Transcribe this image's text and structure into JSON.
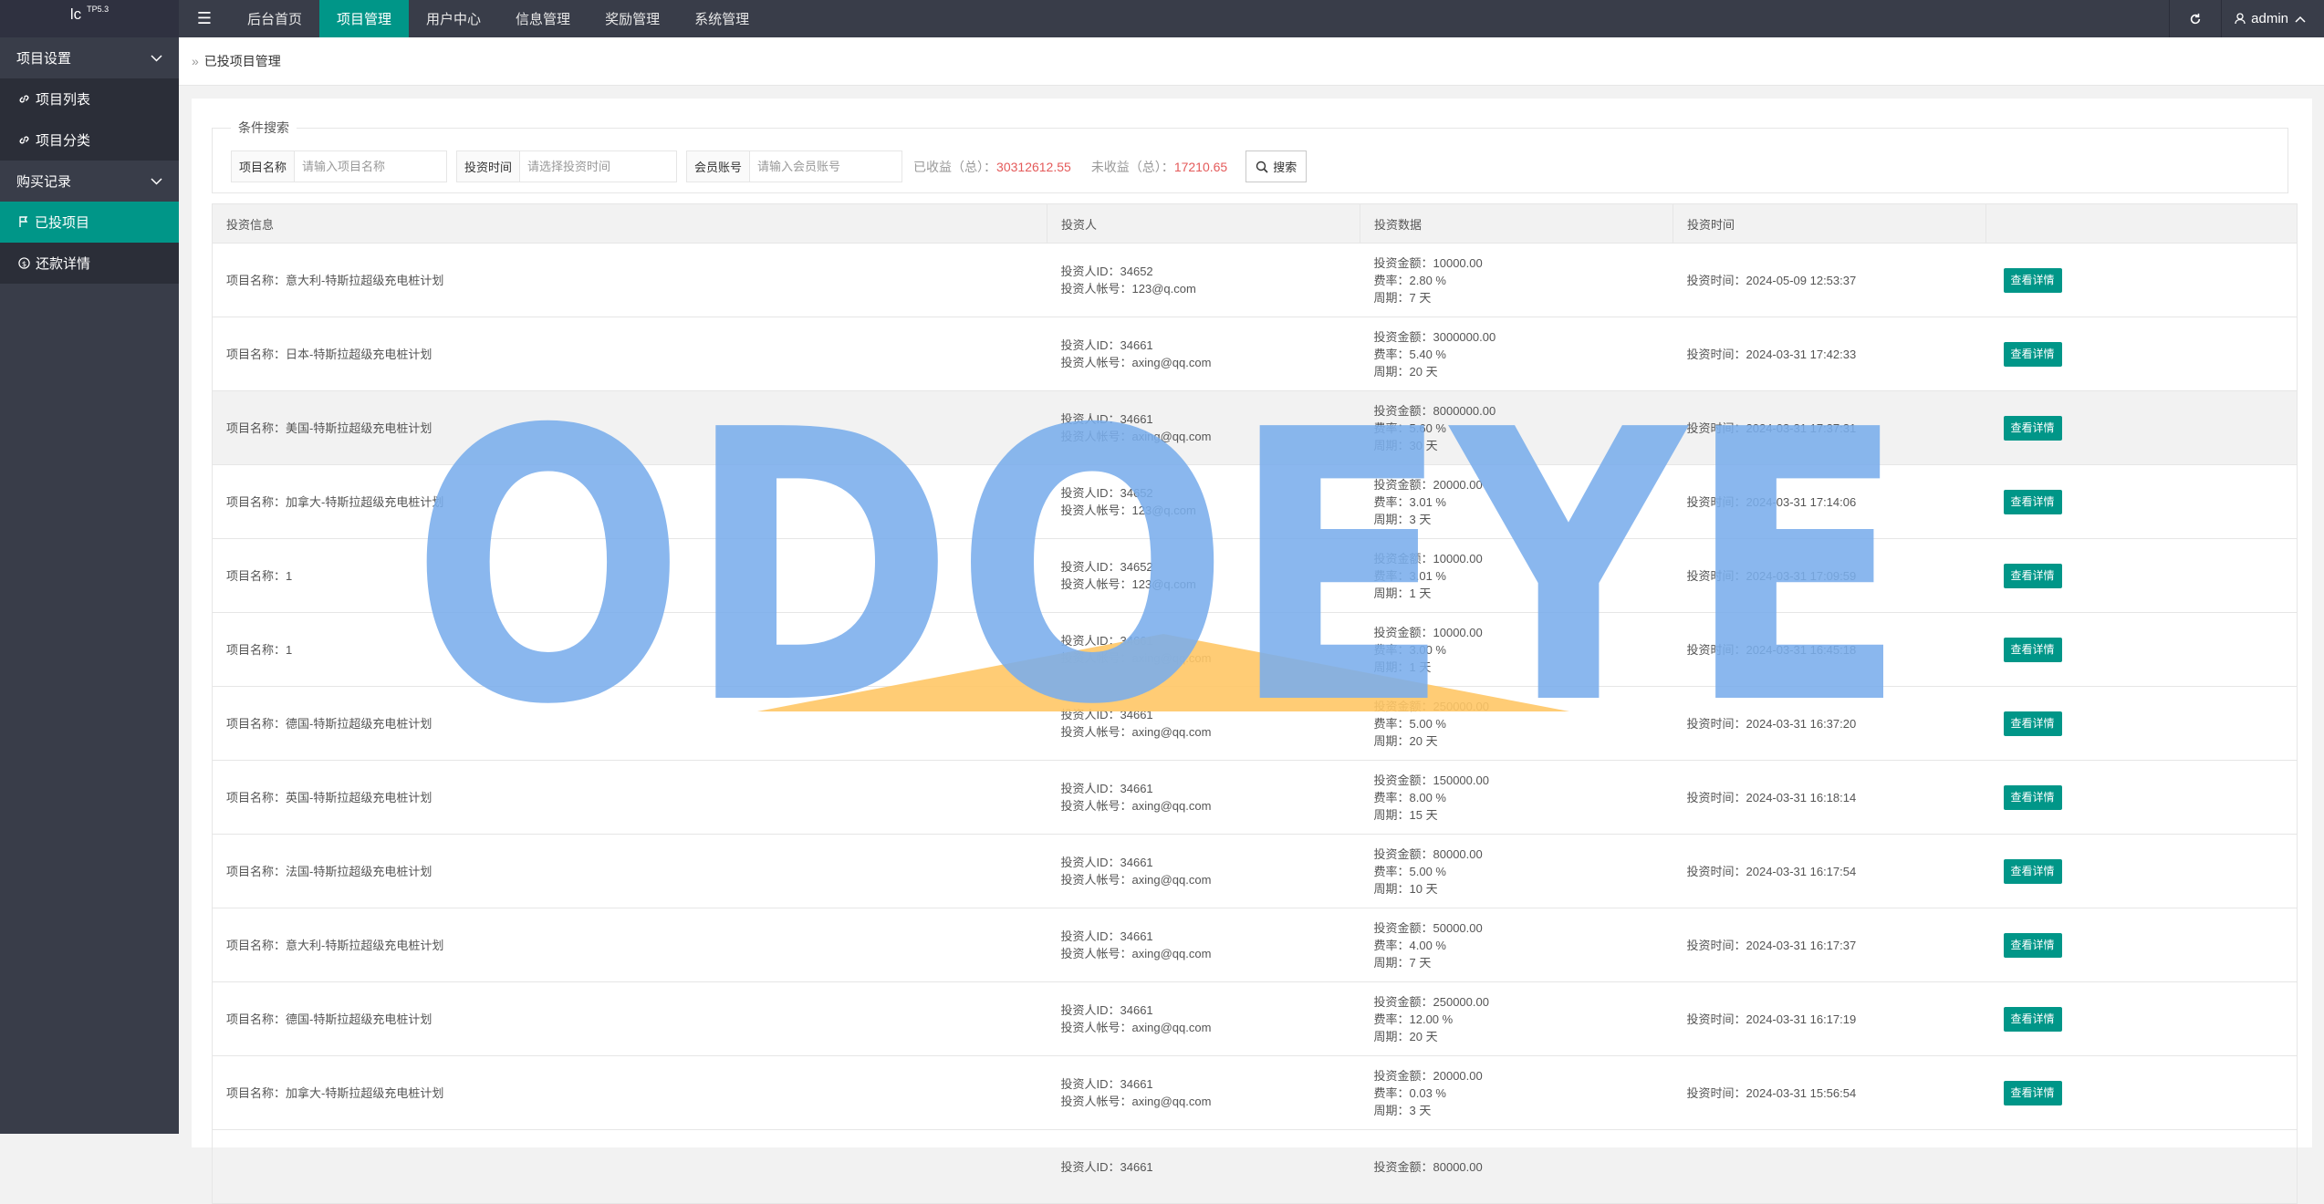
{
  "app": {
    "logo": "lc",
    "version": "TP5.3"
  },
  "topnav": {
    "items": [
      "后台首页",
      "项目管理",
      "用户中心",
      "信息管理",
      "奖励管理",
      "系统管理"
    ],
    "user": "admin"
  },
  "sidebar": {
    "groups": [
      {
        "label": "项目设置",
        "items": [
          "项目列表",
          "项目分类"
        ]
      },
      {
        "label": "购买记录",
        "items": [
          "已投项目",
          "还款详情"
        ]
      }
    ]
  },
  "breadcrumb": {
    "title": "已投项目管理"
  },
  "search": {
    "legend": "条件搜索",
    "fields": [
      {
        "label": "项目名称",
        "placeholder": "请输入项目名称"
      },
      {
        "label": "投资时间",
        "placeholder": "请选择投资时间"
      },
      {
        "label": "会员账号",
        "placeholder": "请输入会员账号"
      }
    ],
    "earned_label": "已收益（总）：",
    "earned_value": "30312612.55",
    "unearned_label": "未收益（总）：",
    "unearned_value": "17210.65",
    "button": "搜索"
  },
  "table": {
    "headers": [
      "投资信息",
      "投资人",
      "投资数据",
      "投资时间",
      ""
    ],
    "detail_label": "查看详情",
    "rows": [
      {
        "name": "项目名称：意大利-特斯拉超级充电桩计划",
        "uid": "投资人ID：34652",
        "account": "投资人帐号：123@q.com",
        "amount": "投资金额：10000.00",
        "rate": "费率：2.80 %",
        "period": "周期：7 天",
        "time": "投资时间：2024-05-09 12:53:37"
      },
      {
        "name": "项目名称：日本-特斯拉超级充电桩计划",
        "uid": "投资人ID：34661",
        "account": "投资人帐号：axing@qq.com",
        "amount": "投资金额：3000000.00",
        "rate": "费率：5.40 %",
        "period": "周期：20 天",
        "time": "投资时间：2024-03-31 17:42:33"
      },
      {
        "name": "项目名称：美国-特斯拉超级充电桩计划",
        "uid": "投资人ID：34661",
        "account": "投资人帐号：axing@qq.com",
        "amount": "投资金额：8000000.00",
        "rate": "费率：5.60 %",
        "period": "周期：30 天",
        "time": "投资时间：2024-03-31 17:37:31"
      },
      {
        "name": "项目名称：加拿大-特斯拉超级充电桩计划",
        "uid": "投资人ID：34652",
        "account": "投资人帐号：123@q.com",
        "amount": "投资金额：20000.00",
        "rate": "费率：3.01 %",
        "period": "周期：3 天",
        "time": "投资时间：2024-03-31 17:14:06"
      },
      {
        "name": "项目名称：1",
        "uid": "投资人ID：34652",
        "account": "投资人帐号：123@q.com",
        "amount": "投资金额：10000.00",
        "rate": "费率：3.01 %",
        "period": "周期：1 天",
        "time": "投资时间：2024-03-31 17:09:59"
      },
      {
        "name": "项目名称：1",
        "uid": "投资人ID：34661",
        "account": "投资人帐号：axing@qq.com",
        "amount": "投资金额：10000.00",
        "rate": "费率：3.00 %",
        "period": "周期：1 天",
        "time": "投资时间：2024-03-31 16:45:18"
      },
      {
        "name": "项目名称：德国-特斯拉超级充电桩计划",
        "uid": "投资人ID：34661",
        "account": "投资人帐号：axing@qq.com",
        "amount": "投资金额：250000.00",
        "rate": "费率：5.00 %",
        "period": "周期：20 天",
        "time": "投资时间：2024-03-31 16:37:20"
      },
      {
        "name": "项目名称：英国-特斯拉超级充电桩计划",
        "uid": "投资人ID：34661",
        "account": "投资人帐号：axing@qq.com",
        "amount": "投资金额：150000.00",
        "rate": "费率：8.00 %",
        "period": "周期：15 天",
        "time": "投资时间：2024-03-31 16:18:14"
      },
      {
        "name": "项目名称：法国-特斯拉超级充电桩计划",
        "uid": "投资人ID：34661",
        "account": "投资人帐号：axing@qq.com",
        "amount": "投资金额：80000.00",
        "rate": "费率：5.00 %",
        "period": "周期：10 天",
        "time": "投资时间：2024-03-31 16:17:54"
      },
      {
        "name": "项目名称：意大利-特斯拉超级充电桩计划",
        "uid": "投资人ID：34661",
        "account": "投资人帐号：axing@qq.com",
        "amount": "投资金额：50000.00",
        "rate": "费率：4.00 %",
        "period": "周期：7 天",
        "time": "投资时间：2024-03-31 16:17:37"
      },
      {
        "name": "项目名称：德国-特斯拉超级充电桩计划",
        "uid": "投资人ID：34661",
        "account": "投资人帐号：axing@qq.com",
        "amount": "投资金额：250000.00",
        "rate": "费率：12.00 %",
        "period": "周期：20 天",
        "time": "投资时间：2024-03-31 16:17:19"
      },
      {
        "name": "项目名称：加拿大-特斯拉超级充电桩计划",
        "uid": "投资人ID：34661",
        "account": "投资人帐号：axing@qq.com",
        "amount": "投资金额：20000.00",
        "rate": "费率：0.03 %",
        "period": "周期：3 天",
        "time": "投资时间：2024-03-31 15:56:54"
      },
      {
        "name": "",
        "uid": "投资人ID：34661",
        "account": "",
        "amount": "投资金额：80000.00",
        "rate": "",
        "period": "",
        "time": ""
      }
    ]
  },
  "watermark": {
    "text": "ODOEYE"
  },
  "colors": {
    "accent": "#009688",
    "header": "#393d49",
    "sidebar": "#393d49",
    "stat_red": "#e45a5a"
  }
}
